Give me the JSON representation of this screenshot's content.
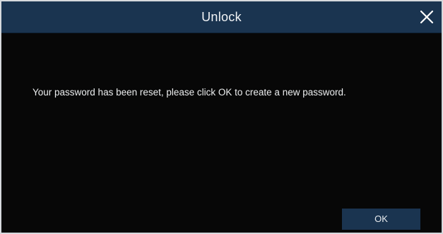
{
  "dialog": {
    "title": "Unlock",
    "close_icon": "close-icon",
    "message": "Your password has been reset, please click OK to create a new password.",
    "ok_label": "OK"
  },
  "colors": {
    "titlebar": "#1a3450",
    "background": "#090909",
    "button": "#1a3450",
    "text": "#eceeef"
  }
}
